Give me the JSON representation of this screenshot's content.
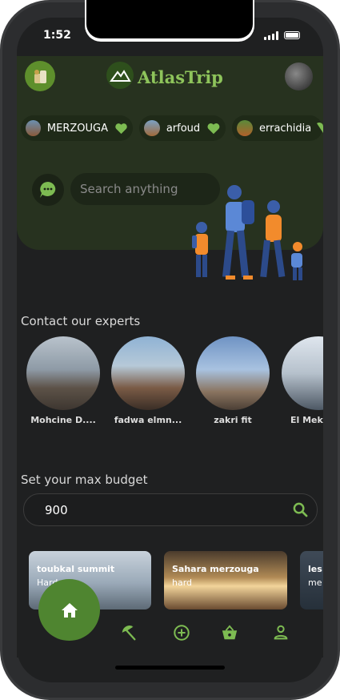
{
  "status_bar": {
    "time": "1:52"
  },
  "app": {
    "title": "AtlasTrip"
  },
  "destinations": [
    {
      "label": "MERZOUGA"
    },
    {
      "label": "arfoud"
    },
    {
      "label": "errachidia"
    }
  ],
  "search": {
    "placeholder": "Search anything"
  },
  "experts": {
    "title": "Contact our experts",
    "items": [
      {
        "name": "Mohcine D...."
      },
      {
        "name": "fadwa elmn..."
      },
      {
        "name": "zakri fit"
      },
      {
        "name": "El Mekk"
      }
    ]
  },
  "budget": {
    "title": "Set your max budget",
    "value": "900"
  },
  "trips": [
    {
      "title": "toubkal summit",
      "level": "Hard"
    },
    {
      "title": "Sahara merzouga",
      "level": "hard"
    },
    {
      "title": "les",
      "level": "me"
    }
  ],
  "nav": {
    "items": [
      "home-icon",
      "umbrella-icon",
      "add-circle-icon",
      "basket-icon",
      "person-icon"
    ]
  },
  "colors": {
    "accent": "#8ec45b",
    "nav_active": "#4f8530",
    "background": "#1f2021",
    "hero": "#27321f"
  }
}
